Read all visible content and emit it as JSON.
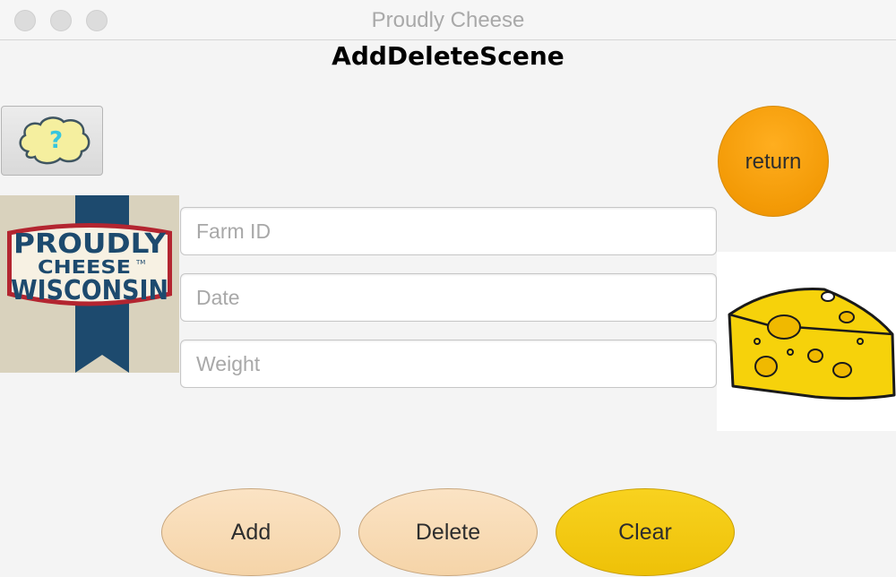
{
  "window": {
    "title": "Proudly Cheese"
  },
  "scene": {
    "title": "AddDeleteScene"
  },
  "help_button": {
    "icon": "question-cloud-icon",
    "label": "?"
  },
  "return_button": {
    "label": "return",
    "color": "#f39a06"
  },
  "logo": {
    "line1": "PROUDLY",
    "line2": "CHEESE",
    "line3": "WISCONSIN",
    "tm": "TM"
  },
  "form": {
    "farm_id": {
      "placeholder": "Farm ID",
      "value": ""
    },
    "date": {
      "placeholder": "Date",
      "value": ""
    },
    "weight": {
      "placeholder": "Weight",
      "value": ""
    }
  },
  "buttons": {
    "add": "Add",
    "delete": "Delete",
    "clear": "Clear"
  },
  "colors": {
    "peach": "#f7d9b2",
    "yellow": "#f2c812",
    "orange": "#f39a06"
  }
}
